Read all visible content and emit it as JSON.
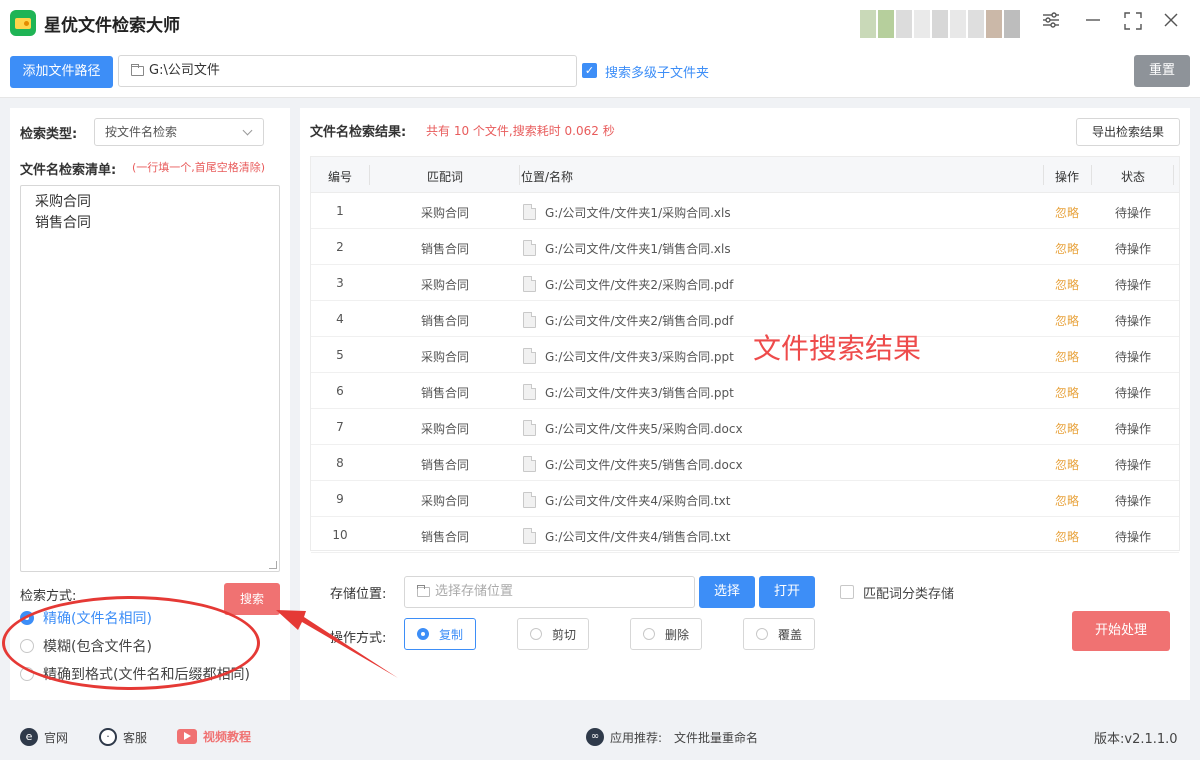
{
  "app": {
    "title": "星优文件检索大师"
  },
  "window": {
    "settings_icon": "sliders-icon",
    "minimize_icon": "minimize-icon",
    "maximize_icon": "maximize-icon",
    "close_icon": "close-icon"
  },
  "toolbar": {
    "add_path_label": "添加文件路径",
    "path_value": "G:\\公司文件",
    "subfolders_label": "搜索多级子文件夹",
    "subfolders_checked": true,
    "reset_label": "重置"
  },
  "left": {
    "search_type_label": "检索类型:",
    "search_type_value": "按文件名检索",
    "list_label": "文件名检索清单:",
    "list_hint": "(一行填一个,首尾空格清除)",
    "list_items": [
      "采购合同",
      "销售合同"
    ],
    "method_label": "检索方式:",
    "search_button": "搜索",
    "methods": [
      {
        "label": "精确(文件名相同)",
        "selected": true
      },
      {
        "label": "模糊(包含文件名)",
        "selected": false
      },
      {
        "label": "精确到格式(文件名和后缀都相同)",
        "selected": false
      }
    ]
  },
  "results": {
    "title": "文件名检索结果:",
    "summary": "共有 10 个文件,搜索耗时 0.062 秒",
    "export_label": "导出检索结果",
    "columns": {
      "num": "编号",
      "keyword": "匹配词",
      "path": "位置/名称",
      "action": "操作",
      "state": "状态"
    },
    "rows": [
      {
        "num": "1",
        "keyword": "采购合同",
        "path": "G:/公司文件/文件夹1/采购合同.xls",
        "action": "忽略",
        "state": "待操作"
      },
      {
        "num": "2",
        "keyword": "销售合同",
        "path": "G:/公司文件/文件夹1/销售合同.xls",
        "action": "忽略",
        "state": "待操作"
      },
      {
        "num": "3",
        "keyword": "采购合同",
        "path": "G:/公司文件/文件夹2/采购合同.pdf",
        "action": "忽略",
        "state": "待操作"
      },
      {
        "num": "4",
        "keyword": "销售合同",
        "path": "G:/公司文件/文件夹2/销售合同.pdf",
        "action": "忽略",
        "state": "待操作"
      },
      {
        "num": "5",
        "keyword": "采购合同",
        "path": "G:/公司文件/文件夹3/采购合同.ppt",
        "action": "忽略",
        "state": "待操作"
      },
      {
        "num": "6",
        "keyword": "销售合同",
        "path": "G:/公司文件/文件夹3/销售合同.ppt",
        "action": "忽略",
        "state": "待操作"
      },
      {
        "num": "7",
        "keyword": "采购合同",
        "path": "G:/公司文件/文件夹5/采购合同.docx",
        "action": "忽略",
        "state": "待操作"
      },
      {
        "num": "8",
        "keyword": "销售合同",
        "path": "G:/公司文件/文件夹5/销售合同.docx",
        "action": "忽略",
        "state": "待操作"
      },
      {
        "num": "9",
        "keyword": "采购合同",
        "path": "G:/公司文件/文件夹4/采购合同.txt",
        "action": "忽略",
        "state": "待操作"
      },
      {
        "num": "10",
        "keyword": "销售合同",
        "path": "G:/公司文件/文件夹4/销售合同.txt",
        "action": "忽略",
        "state": "待操作"
      }
    ],
    "watermark": "文件搜索结果"
  },
  "bottom": {
    "storage_label": "存储位置:",
    "storage_placeholder": "选择存储位置",
    "choose_label": "选择",
    "open_label": "打开",
    "classify_label": "匹配词分类存储",
    "classify_checked": false,
    "op_label": "操作方式:",
    "ops": [
      {
        "label": "复制",
        "selected": true
      },
      {
        "label": "剪切",
        "selected": false
      },
      {
        "label": "删除",
        "selected": false
      },
      {
        "label": "覆盖",
        "selected": false
      }
    ],
    "start_label": "开始处理"
  },
  "footer": {
    "website": "官网",
    "support": "客服",
    "video": "视频教程",
    "recommend_label": "应用推荐:",
    "recommend_app": "文件批量重命名",
    "version": "版本:v2.1.1.0"
  },
  "colors": {
    "accent": "#3d8ef7",
    "danger": "#f07272",
    "warning": "#e8a33d",
    "annotation": "#e53935"
  }
}
